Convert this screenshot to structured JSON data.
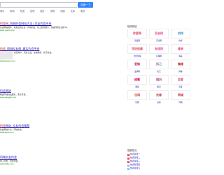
{
  "search": {
    "button": "百度一下"
  },
  "tabs": [
    "网页",
    "新闻",
    "知道",
    "贴吧",
    "图片",
    "视频",
    "地图",
    "文库",
    "更多"
  ],
  "results": [
    {
      "title_hl": "约会网",
      "title": "_同城约会网站大全 | 交友约会平台",
      "desc": "约会网站推荐：真实征婚交友，同城约会，线上配对服务，快速找到身边的TA。",
      "url": "www.yuehui.com"
    },
    {
      "title_hl": "约会",
      "title": "_同城交友网_真实约会平台",
      "desc": "真实用户，实名认证，在线聊天，线下约会。",
      "url": "www.jiaoyou.com"
    },
    {
      "title": "约会网站",
      "desc": "精选同城约会服务，安全可靠。",
      "url": "www.xiangqin.com"
    },
    {
      "title_hl": "约会",
      "title": "网站_交友约会推荐",
      "desc": "约会网站大全，同城交友。",
      "url": "www.aiyue.com"
    },
    {
      "title": "同城交友约会",
      "desc": "线上交友，轻松约会。",
      "url": "www.baihe.com"
    }
  ],
  "right": {
    "title": "相关网站",
    "sites": [
      {
        "logo": "珍爱网",
        "label": "珍爱网",
        "color": "#e8426a"
      },
      {
        "logo": "百合网",
        "label": "百合网",
        "color": "#e84a8a"
      },
      {
        "logo": "约伴",
        "label": "约伴",
        "color": "#3a86d4"
      },
      {
        "logo": "世纪佳缘",
        "label": "世纪佳缘",
        "color": "#d9465a"
      },
      {
        "logo": "有缘网",
        "label": "有缘网",
        "color": "#e85aa0"
      },
      {
        "logo": "缘来",
        "label": "缘来",
        "color": "#e0457a"
      },
      {
        "logo": "爱情",
        "label": "爱情网",
        "color": "#c3306a"
      },
      {
        "logo": "知己",
        "label": "知己",
        "color": "#888888"
      },
      {
        "logo": "情缘",
        "label": "情缘",
        "color": "#b33"
      },
      {
        "logo": "甜蜜",
        "label": "甜蜜",
        "color": "#e05"
      },
      {
        "logo": "相识",
        "label": "相识",
        "color": "#a36"
      },
      {
        "logo": "恋爱",
        "label": "恋爱",
        "color": "#c47"
      },
      {
        "logo": "佳偶",
        "label": "佳偶",
        "color": "#d55"
      },
      {
        "logo": "良缘",
        "label": "良缘",
        "color": "#b45"
      },
      {
        "logo": "同城",
        "label": "同城",
        "color": "#c35"
      }
    ],
    "hot_title": "搜索热点",
    "hot": [
      "热点新闻一",
      "热点新闻二",
      "热点新闻三",
      "热点新闻四",
      "热点新闻五"
    ]
  }
}
